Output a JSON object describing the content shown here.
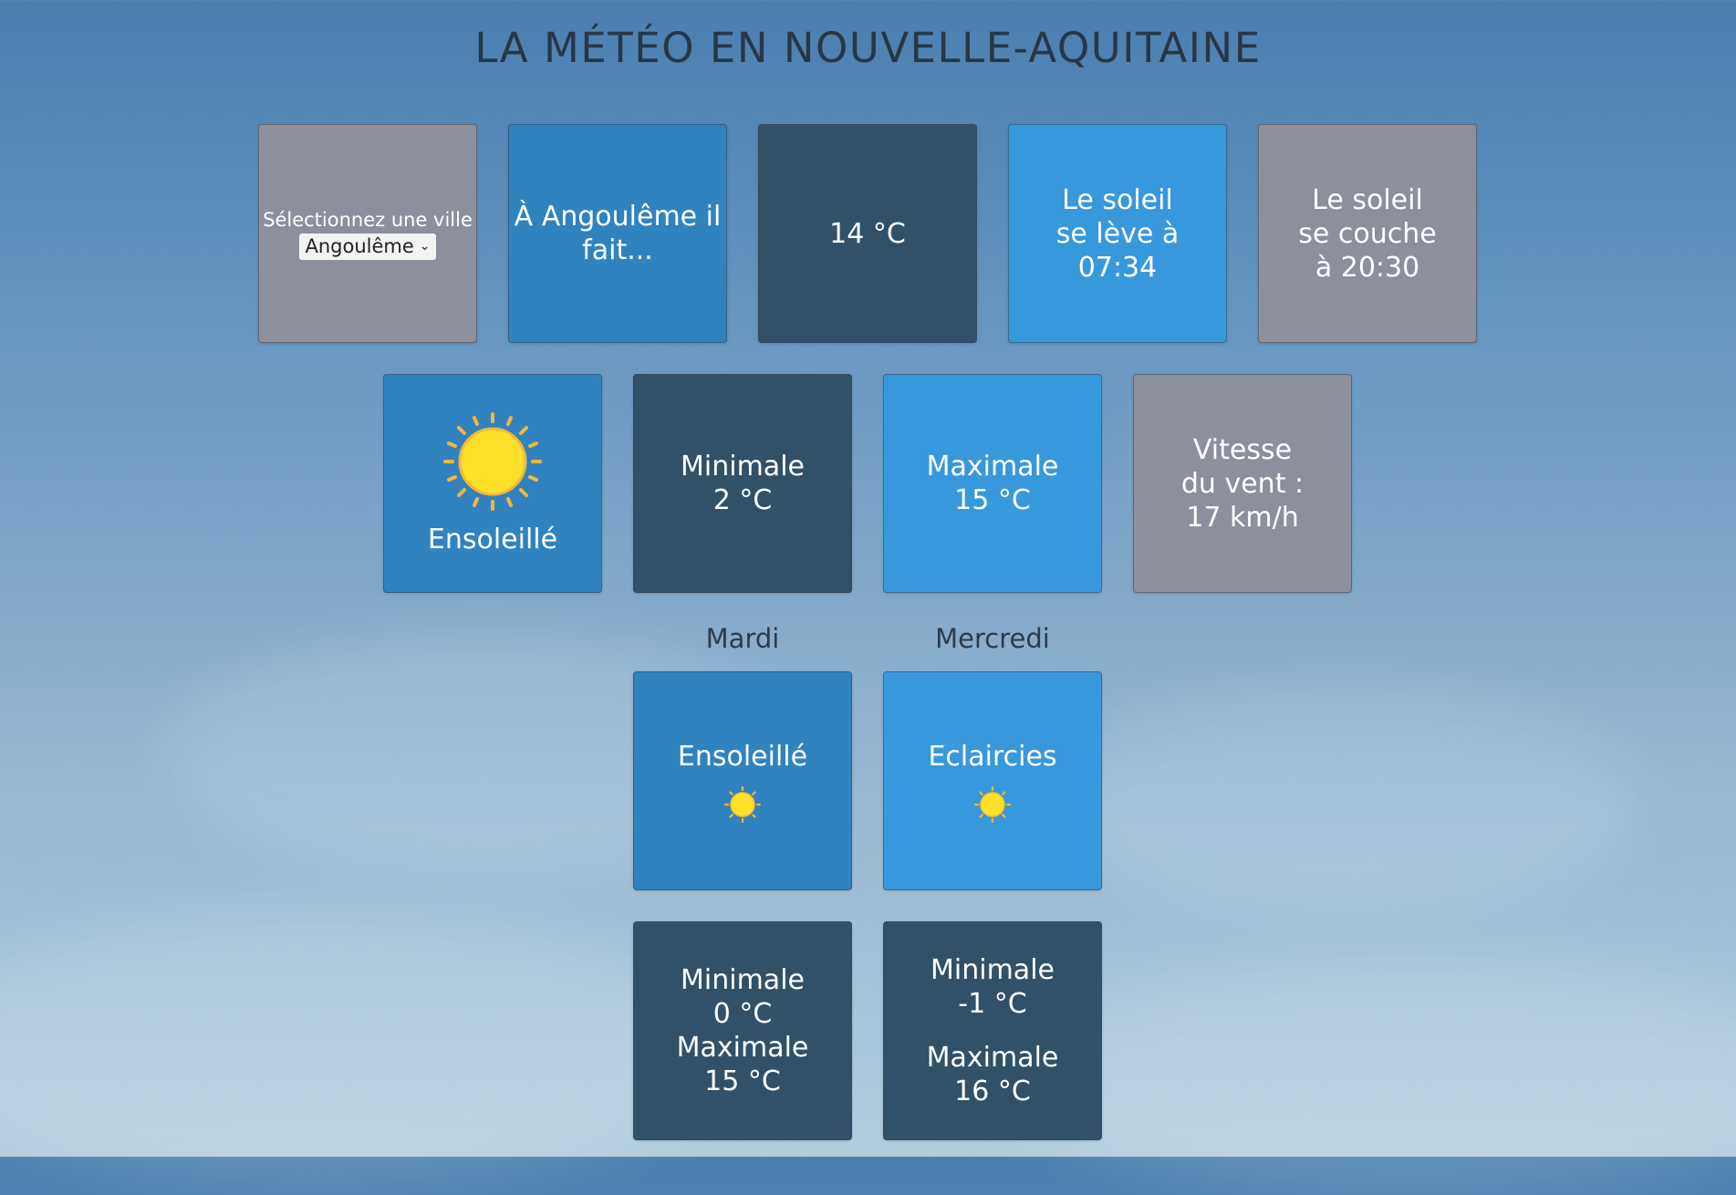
{
  "page": {
    "title": "LA MÉTÉO EN NOUVELLE-AQUITAINE"
  },
  "selector": {
    "label": "Sélectionnez une ville",
    "selected": "Angoulême"
  },
  "intro": {
    "line1": "À Angoulême il",
    "line2": "fait..."
  },
  "current_temp": "14 °C",
  "sunrise": {
    "line1": "Le soleil",
    "line2": "se lève à",
    "line3": "07:34"
  },
  "sunset": {
    "line1": "Le soleil",
    "line2": "se couche",
    "line3": "à 20:30"
  },
  "today": {
    "condition": "Ensoleillé",
    "icon": "sun-icon",
    "min_label": "Minimale",
    "min_value": "2 °C",
    "max_label": "Maximale",
    "max_value": "15 °C",
    "wind_line1": "Vitesse",
    "wind_line2": "du vent :",
    "wind_value": "17 km/h"
  },
  "forecast": [
    {
      "day": "Mardi",
      "condition": "Ensoleillé",
      "icon": "sun-icon",
      "min_label": "Minimale",
      "min_value": "0 °C",
      "max_label": "Maximale",
      "max_value": "15 °C"
    },
    {
      "day": "Mercredi",
      "condition": "Eclaircies",
      "icon": "sun-icon",
      "min_label": "Minimale",
      "min_value": "-1 °C",
      "max_label": "Maximale",
      "max_value": "16 °C"
    }
  ],
  "colors": {
    "tile_grey": "#8b909c",
    "tile_blue": "#3083be",
    "tile_dark": "#305168",
    "tile_light": "#3898dc",
    "sun": "#fde02a",
    "sun_rays": "#f4b63a"
  }
}
